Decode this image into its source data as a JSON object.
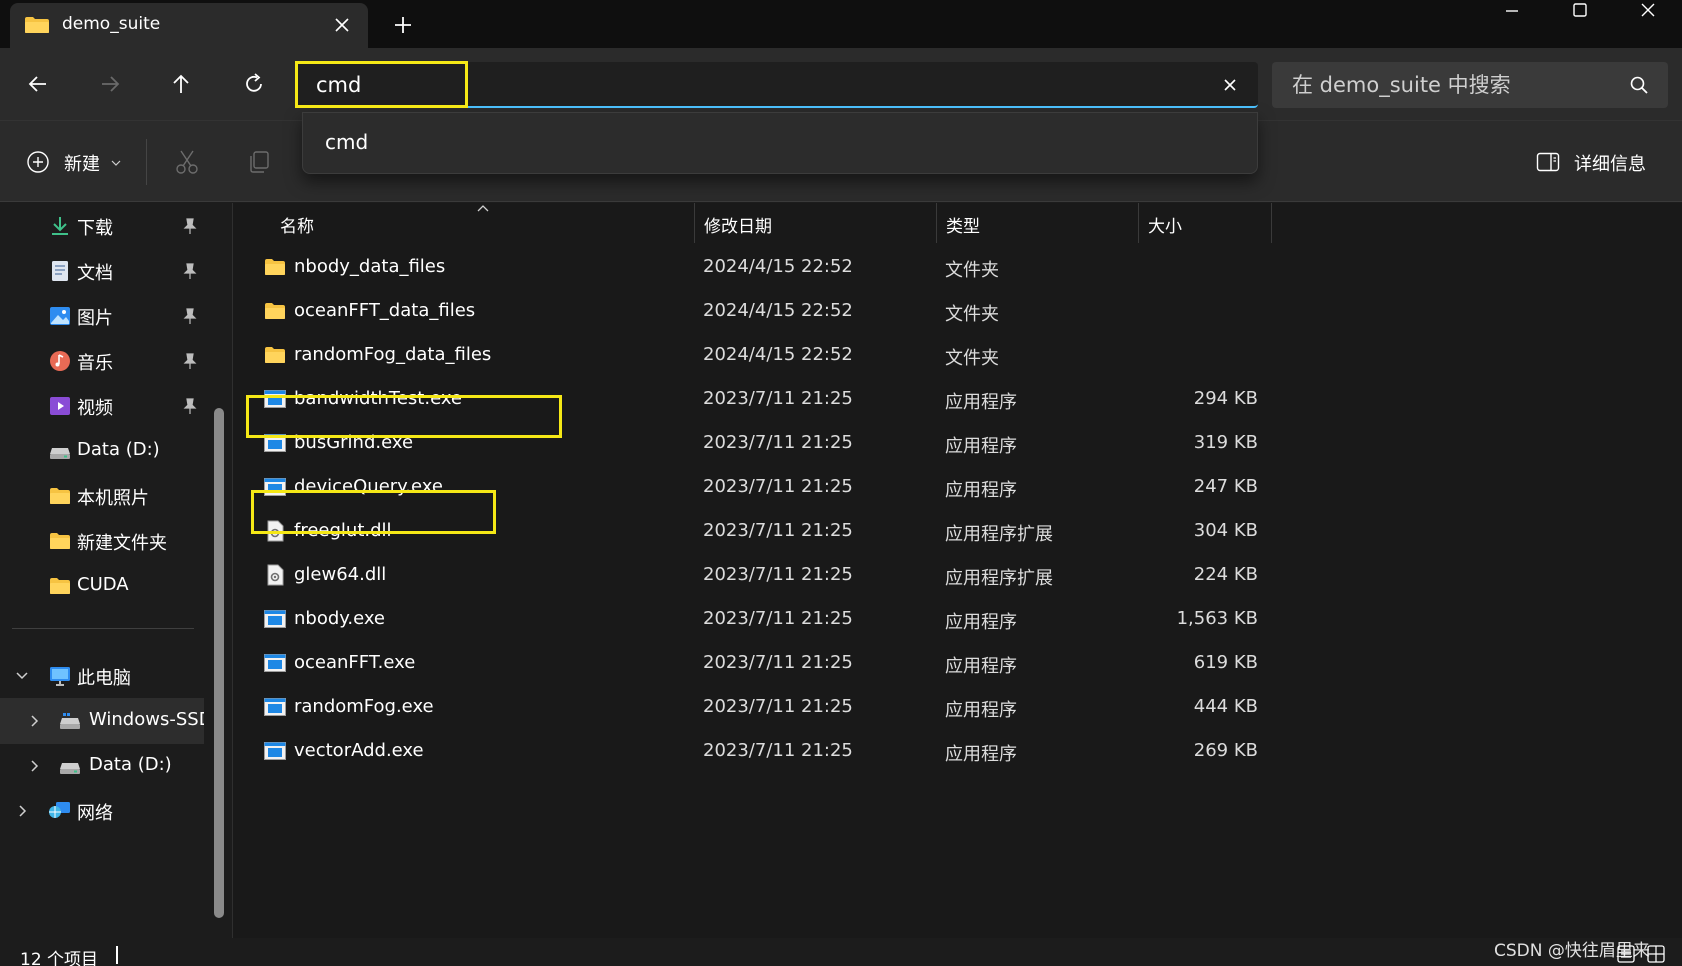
{
  "tab": {
    "title": "demo_suite"
  },
  "address": {
    "value": "cmd"
  },
  "search": {
    "placeholder": "在 demo_suite 中搜索"
  },
  "suggestion": {
    "item": "cmd"
  },
  "commandbar": {
    "new_label": "新建",
    "details_label": "详细信息"
  },
  "sidebar": {
    "quick_access": [
      {
        "label": "下载",
        "icon": "download-icon",
        "pinned": true
      },
      {
        "label": "文档",
        "icon": "document-icon",
        "pinned": true
      },
      {
        "label": "图片",
        "icon": "pictures-icon",
        "pinned": true
      },
      {
        "label": "音乐",
        "icon": "music-icon",
        "pinned": true
      },
      {
        "label": "视频",
        "icon": "video-icon",
        "pinned": true
      },
      {
        "label": "Data (D:)",
        "icon": "drive-icon",
        "pinned": false
      },
      {
        "label": "本机照片",
        "icon": "folder-icon",
        "pinned": false
      },
      {
        "label": "新建文件夹",
        "icon": "folder-icon",
        "pinned": false
      },
      {
        "label": "CUDA",
        "icon": "folder-icon",
        "pinned": false
      }
    ],
    "this_pc": "此电脑",
    "windows_ssd": "Windows-SSD",
    "data_drive": "Data (D:)",
    "network": "网络"
  },
  "columns": {
    "name": "名称",
    "date": "修改日期",
    "type": "类型",
    "size": "大小"
  },
  "files": [
    {
      "name": "nbody_data_files",
      "date": "2024/4/15 22:52",
      "type": "文件夹",
      "size": "",
      "icon": "folder-icon"
    },
    {
      "name": "oceanFFT_data_files",
      "date": "2024/4/15 22:52",
      "type": "文件夹",
      "size": "",
      "icon": "folder-icon"
    },
    {
      "name": "randomFog_data_files",
      "date": "2024/4/15 22:52",
      "type": "文件夹",
      "size": "",
      "icon": "folder-icon"
    },
    {
      "name": "bandwidthTest.exe",
      "date": "2023/7/11 21:25",
      "type": "应用程序",
      "size": "294 KB",
      "icon": "exe-icon"
    },
    {
      "name": "busGrind.exe",
      "date": "2023/7/11 21:25",
      "type": "应用程序",
      "size": "319 KB",
      "icon": "exe-icon"
    },
    {
      "name": "deviceQuery.exe",
      "date": "2023/7/11 21:25",
      "type": "应用程序",
      "size": "247 KB",
      "icon": "exe-icon"
    },
    {
      "name": "freeglut.dll",
      "date": "2023/7/11 21:25",
      "type": "应用程序扩展",
      "size": "304 KB",
      "icon": "dll-icon"
    },
    {
      "name": "glew64.dll",
      "date": "2023/7/11 21:25",
      "type": "应用程序扩展",
      "size": "224 KB",
      "icon": "dll-icon"
    },
    {
      "name": "nbody.exe",
      "date": "2023/7/11 21:25",
      "type": "应用程序",
      "size": "1,563 KB",
      "icon": "exe-icon"
    },
    {
      "name": "oceanFFT.exe",
      "date": "2023/7/11 21:25",
      "type": "应用程序",
      "size": "619 KB",
      "icon": "exe-icon"
    },
    {
      "name": "randomFog.exe",
      "date": "2023/7/11 21:25",
      "type": "应用程序",
      "size": "444 KB",
      "icon": "exe-icon"
    },
    {
      "name": "vectorAdd.exe",
      "date": "2023/7/11 21:25",
      "type": "应用程序",
      "size": "269 KB",
      "icon": "exe-icon"
    }
  ],
  "status": {
    "count": "12 个项目"
  },
  "watermark": "CSDN @快往眉里来",
  "colors": {
    "accent": "#4cc2ff",
    "highlight": "#f5e816",
    "folder": "#f6c342",
    "exe": "#1e88e5"
  }
}
